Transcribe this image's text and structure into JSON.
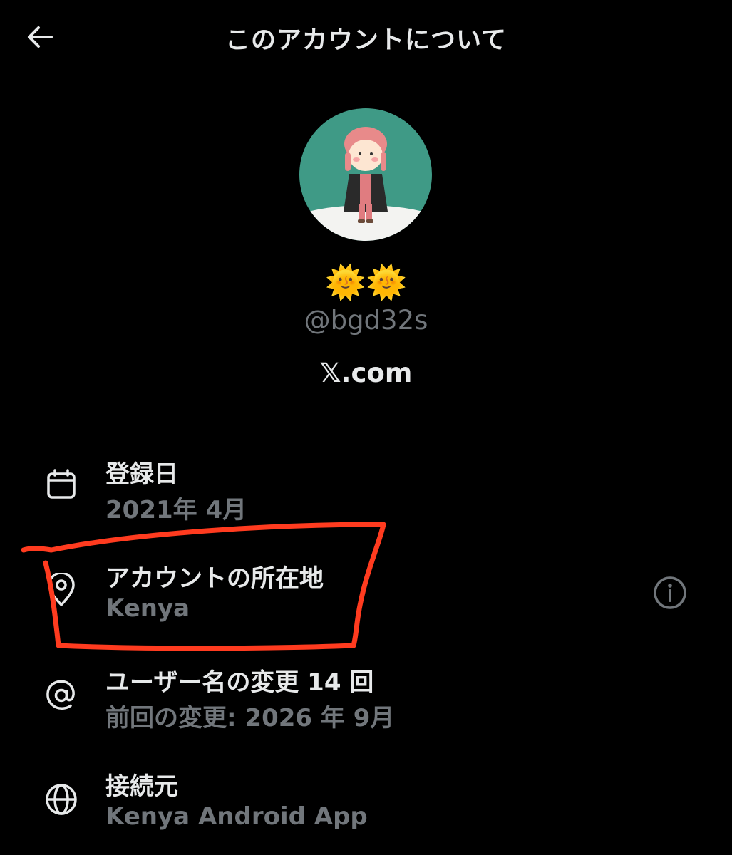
{
  "header": {
    "title": "このアカウントについて",
    "back_icon": "arrow-left-icon"
  },
  "profile": {
    "display_name": "🌞🌞",
    "handle": "@bgd32s",
    "site": "𝕏.com"
  },
  "details": [
    {
      "icon": "calendar-icon",
      "label": "登録日",
      "value": "2021年 4月"
    },
    {
      "icon": "location-pin-icon",
      "label": "アカウントの所在地",
      "value": "Kenya",
      "info_icon": "info-icon"
    },
    {
      "icon": "at-sign-icon",
      "label": "ユーザー名の変更 14 回",
      "value": "前回の変更: 2026 年 9月"
    },
    {
      "icon": "globe-icon",
      "label": "接続元",
      "value": "Kenya Android App"
    }
  ],
  "colors": {
    "background": "#000000",
    "text_primary": "#e7e9ea",
    "text_secondary": "#71767b",
    "annotation": "#ff3b1f",
    "avatar_bg": "#3f9a86"
  }
}
